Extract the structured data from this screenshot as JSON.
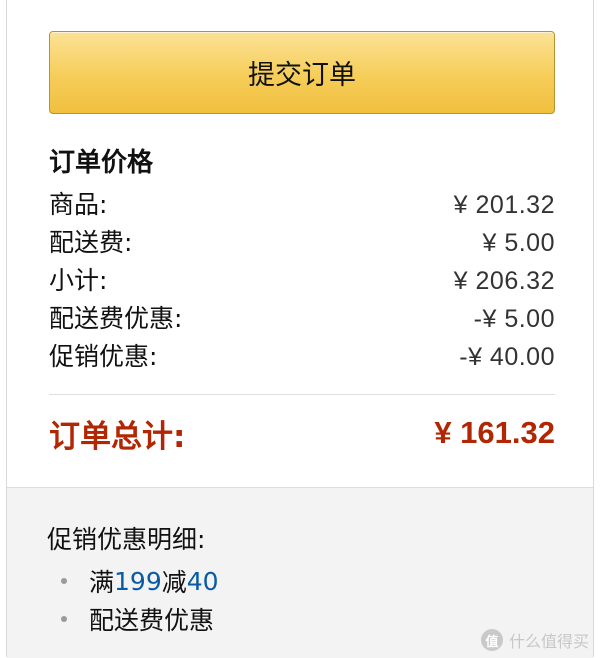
{
  "submit_button": {
    "label": "提交订单"
  },
  "summary": {
    "title": "订单价格",
    "rows": [
      {
        "label": "商品:",
        "amount": "¥ 201.32"
      },
      {
        "label": "配送费:",
        "amount": "¥ 5.00"
      },
      {
        "label": "小计:",
        "amount": "¥ 206.32"
      },
      {
        "label": "配送费优惠:",
        "amount": "-¥ 5.00"
      },
      {
        "label": "促销优惠:",
        "amount": "-¥ 40.00"
      }
    ]
  },
  "total": {
    "label": "订单总计:",
    "amount": "¥ 161.32"
  },
  "promo_details": {
    "title": "促销优惠明细:",
    "items": [
      {
        "prefix": "满",
        "link": "199",
        "mid": "减",
        "link2": "40"
      },
      {
        "text": "配送费优惠"
      }
    ]
  },
  "watermark": {
    "text": "什么值得买"
  },
  "colors": {
    "button_top": "#fbe296",
    "button_bottom": "#f0bf3e",
    "total": "#b12704",
    "link": "#0a5aa5"
  }
}
